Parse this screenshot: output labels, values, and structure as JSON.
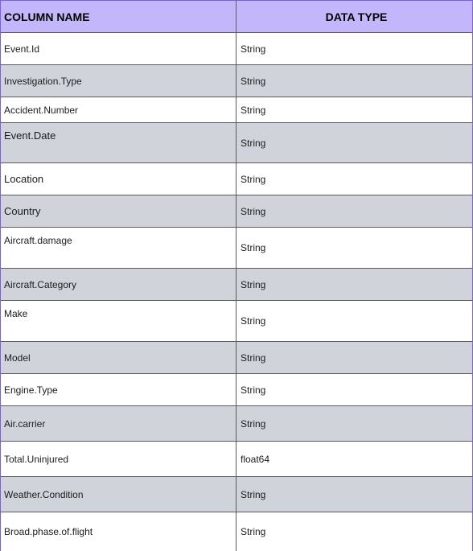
{
  "header": {
    "column_name": "COLUMN NAME",
    "data_type": "DATA TYPE"
  },
  "rows": [
    {
      "name": "Event.Id",
      "type": "String"
    },
    {
      "name": "Investigation.Type",
      "type": "String"
    },
    {
      "name": "Accident.Number",
      "type": "String"
    },
    {
      "name": "Event.Date",
      "type": "String"
    },
    {
      "name": "Location",
      "type": "String"
    },
    {
      "name": "Country",
      "type": "String"
    },
    {
      "name": "Aircraft.damage",
      "type": "String"
    },
    {
      "name": "Aircraft.Category",
      "type": "String"
    },
    {
      "name": "Make",
      "type": "String"
    },
    {
      "name": "Model",
      "type": "String"
    },
    {
      "name": "Engine.Type",
      "type": "String"
    },
    {
      "name": "Air.carrier",
      "type": "String"
    },
    {
      "name": "Total.Uninjured",
      "type": "float64"
    },
    {
      "name": "Weather.Condition",
      "type": "String"
    },
    {
      "name": "Broad.phase.of.flight",
      "type": "String"
    }
  ],
  "colors": {
    "header_bg": "#c3b6fb",
    "alt_row_bg": "#d0d3da",
    "border_accent": "#7d5fd6"
  }
}
